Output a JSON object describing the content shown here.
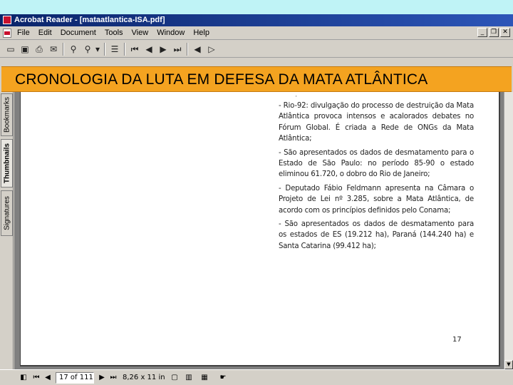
{
  "window": {
    "title": "Acrobat Reader - [mataatlantica-ISA.pdf]",
    "controls": [
      "_",
      "❐",
      "✕"
    ]
  },
  "menubar": {
    "items": [
      "File",
      "Edit",
      "Document",
      "Tools",
      "View",
      "Window",
      "Help"
    ],
    "doc_controls": [
      "_",
      "❐",
      "✕"
    ]
  },
  "toolbar": {
    "icons": [
      "open-icon",
      "save-icon",
      "print-icon",
      "email-icon",
      "search-icon",
      "find-icon",
      "dropdown-icon",
      "page-icon",
      "first-page-icon",
      "previous-page-icon",
      "next-page-icon",
      "last-page-icon",
      "back-icon",
      "forward-icon"
    ]
  },
  "banner": {
    "text": "CRONOLOGIA DA LUTA EM DEFESA DA MATA ATLÂNTICA"
  },
  "side_tabs": [
    "Bookmarks",
    "Thumbnails",
    "Signatures"
  ],
  "document": {
    "paragraphs": [
      "- Rio-92: divulgação do processo de destruição da Mata Atlântica provoca intensos e acalorados debates no Fórum Global. É criada a Rede de ONGs da Mata Atlântica;",
      "- São apresentados os dados de desmatamento para o Estado de São Paulo: no período 85-90 o estado eliminou 61.720, o dobro do Rio de Janeiro;",
      "- Deputado Fábio Feldmann apresenta na Câmara o Projeto de Lei nº 3.285, sobre a Mata Atlântica, de acordo com os princípios definidos pelo Conama;",
      "- São apresentados os dados de desmatamento para os estados de ES (19.212 ha), Paraná (144.240 ha) e Santa Catarina (99.412 ha);"
    ],
    "page_number": "17"
  },
  "statusbar": {
    "page_display": "17 of 111",
    "page_size": "8,26 x 11 in"
  }
}
